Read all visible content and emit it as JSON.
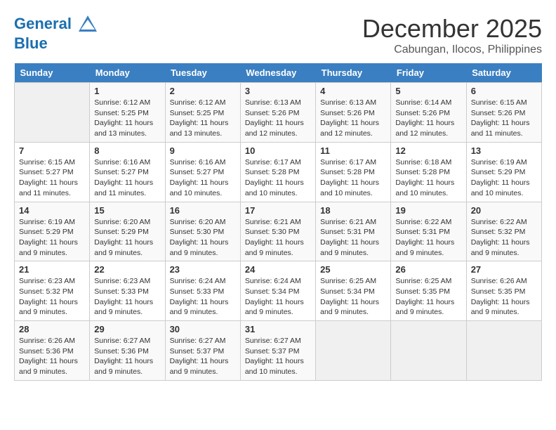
{
  "header": {
    "logo_line1": "General",
    "logo_line2": "Blue",
    "month": "December 2025",
    "location": "Cabungan, Ilocos, Philippines"
  },
  "days_of_week": [
    "Sunday",
    "Monday",
    "Tuesday",
    "Wednesday",
    "Thursday",
    "Friday",
    "Saturday"
  ],
  "weeks": [
    [
      {
        "day": "",
        "empty": true
      },
      {
        "day": "1",
        "sunrise": "6:12 AM",
        "sunset": "5:25 PM",
        "daylight": "11 hours and 13 minutes."
      },
      {
        "day": "2",
        "sunrise": "6:12 AM",
        "sunset": "5:25 PM",
        "daylight": "11 hours and 13 minutes."
      },
      {
        "day": "3",
        "sunrise": "6:13 AM",
        "sunset": "5:26 PM",
        "daylight": "11 hours and 12 minutes."
      },
      {
        "day": "4",
        "sunrise": "6:13 AM",
        "sunset": "5:26 PM",
        "daylight": "11 hours and 12 minutes."
      },
      {
        "day": "5",
        "sunrise": "6:14 AM",
        "sunset": "5:26 PM",
        "daylight": "11 hours and 12 minutes."
      },
      {
        "day": "6",
        "sunrise": "6:15 AM",
        "sunset": "5:26 PM",
        "daylight": "11 hours and 11 minutes."
      }
    ],
    [
      {
        "day": "7",
        "sunrise": "6:15 AM",
        "sunset": "5:27 PM",
        "daylight": "11 hours and 11 minutes."
      },
      {
        "day": "8",
        "sunrise": "6:16 AM",
        "sunset": "5:27 PM",
        "daylight": "11 hours and 11 minutes."
      },
      {
        "day": "9",
        "sunrise": "6:16 AM",
        "sunset": "5:27 PM",
        "daylight": "11 hours and 10 minutes."
      },
      {
        "day": "10",
        "sunrise": "6:17 AM",
        "sunset": "5:28 PM",
        "daylight": "11 hours and 10 minutes."
      },
      {
        "day": "11",
        "sunrise": "6:17 AM",
        "sunset": "5:28 PM",
        "daylight": "11 hours and 10 minutes."
      },
      {
        "day": "12",
        "sunrise": "6:18 AM",
        "sunset": "5:28 PM",
        "daylight": "11 hours and 10 minutes."
      },
      {
        "day": "13",
        "sunrise": "6:19 AM",
        "sunset": "5:29 PM",
        "daylight": "11 hours and 10 minutes."
      }
    ],
    [
      {
        "day": "14",
        "sunrise": "6:19 AM",
        "sunset": "5:29 PM",
        "daylight": "11 hours and 9 minutes."
      },
      {
        "day": "15",
        "sunrise": "6:20 AM",
        "sunset": "5:29 PM",
        "daylight": "11 hours and 9 minutes."
      },
      {
        "day": "16",
        "sunrise": "6:20 AM",
        "sunset": "5:30 PM",
        "daylight": "11 hours and 9 minutes."
      },
      {
        "day": "17",
        "sunrise": "6:21 AM",
        "sunset": "5:30 PM",
        "daylight": "11 hours and 9 minutes."
      },
      {
        "day": "18",
        "sunrise": "6:21 AM",
        "sunset": "5:31 PM",
        "daylight": "11 hours and 9 minutes."
      },
      {
        "day": "19",
        "sunrise": "6:22 AM",
        "sunset": "5:31 PM",
        "daylight": "11 hours and 9 minutes."
      },
      {
        "day": "20",
        "sunrise": "6:22 AM",
        "sunset": "5:32 PM",
        "daylight": "11 hours and 9 minutes."
      }
    ],
    [
      {
        "day": "21",
        "sunrise": "6:23 AM",
        "sunset": "5:32 PM",
        "daylight": "11 hours and 9 minutes."
      },
      {
        "day": "22",
        "sunrise": "6:23 AM",
        "sunset": "5:33 PM",
        "daylight": "11 hours and 9 minutes."
      },
      {
        "day": "23",
        "sunrise": "6:24 AM",
        "sunset": "5:33 PM",
        "daylight": "11 hours and 9 minutes."
      },
      {
        "day": "24",
        "sunrise": "6:24 AM",
        "sunset": "5:34 PM",
        "daylight": "11 hours and 9 minutes."
      },
      {
        "day": "25",
        "sunrise": "6:25 AM",
        "sunset": "5:34 PM",
        "daylight": "11 hours and 9 minutes."
      },
      {
        "day": "26",
        "sunrise": "6:25 AM",
        "sunset": "5:35 PM",
        "daylight": "11 hours and 9 minutes."
      },
      {
        "day": "27",
        "sunrise": "6:26 AM",
        "sunset": "5:35 PM",
        "daylight": "11 hours and 9 minutes."
      }
    ],
    [
      {
        "day": "28",
        "sunrise": "6:26 AM",
        "sunset": "5:36 PM",
        "daylight": "11 hours and 9 minutes."
      },
      {
        "day": "29",
        "sunrise": "6:27 AM",
        "sunset": "5:36 PM",
        "daylight": "11 hours and 9 minutes."
      },
      {
        "day": "30",
        "sunrise": "6:27 AM",
        "sunset": "5:37 PM",
        "daylight": "11 hours and 9 minutes."
      },
      {
        "day": "31",
        "sunrise": "6:27 AM",
        "sunset": "5:37 PM",
        "daylight": "11 hours and 10 minutes."
      },
      {
        "day": "",
        "empty": true
      },
      {
        "day": "",
        "empty": true
      },
      {
        "day": "",
        "empty": true
      }
    ]
  ],
  "labels": {
    "sunrise_prefix": "Sunrise: ",
    "sunset_prefix": "Sunset: ",
    "daylight_prefix": "Daylight: "
  }
}
